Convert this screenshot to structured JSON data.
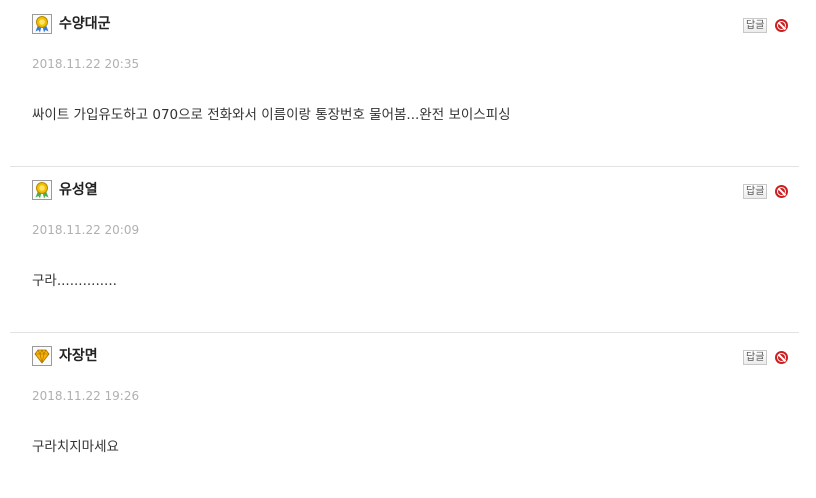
{
  "colors": {
    "delete": "#cc1f1f",
    "date": "#b0b0b0",
    "separator": "#e2e2e2"
  },
  "comments": [
    {
      "author": "수양대군",
      "badge_icon": "gold-medal-ribbon-icon",
      "date": "2018.11.22 20:35",
      "text": "싸이트 가입유도하고 070으로 전화와서 이름이랑 통장번호 물어봄...완전 보이스피싱",
      "reply_label": "답글",
      "delete_icon": "delete-icon"
    },
    {
      "author": "유성열",
      "badge_icon": "gold-medal-ribbon-icon",
      "date": "2018.11.22 20:09",
      "text": "구라..............",
      "reply_label": "답글",
      "delete_icon": "delete-icon"
    },
    {
      "author": "자장면",
      "badge_icon": "diamond-icon",
      "date": "2018.11.22 19:26",
      "text": "구라치지마세요",
      "reply_label": "답글",
      "delete_icon": "delete-icon"
    }
  ]
}
